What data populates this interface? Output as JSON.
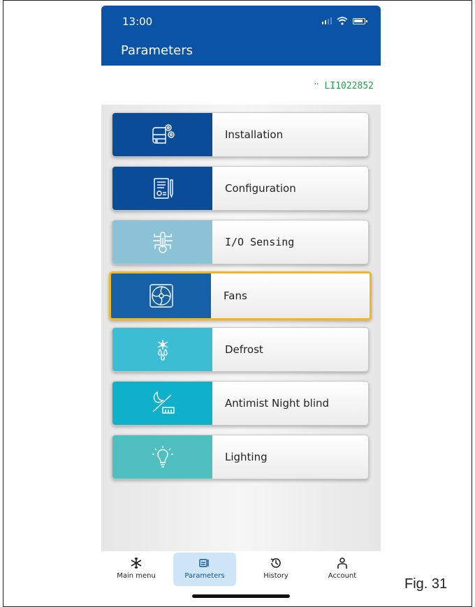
{
  "status_bar": {
    "time": "13:00"
  },
  "header": {
    "title": "Parameters"
  },
  "device": {
    "id": "LI1022852",
    "connection_icon": "bluetooth-signal-icon",
    "color": "#1aa34a"
  },
  "menu": {
    "items": [
      {
        "label": "Installation",
        "icon": "installation-icon",
        "icon_bg": "#0a4c98"
      },
      {
        "label": "Configuration",
        "icon": "configuration-icon",
        "icon_bg": "#0a4c98"
      },
      {
        "label": "I/O Sensing",
        "icon": "thermometer-icon",
        "icon_bg": "#8cc2d6"
      },
      {
        "label": "Fans",
        "icon": "fan-icon",
        "icon_bg": "#1660a8",
        "selected": true
      },
      {
        "label": "Defrost",
        "icon": "defrost-icon",
        "icon_bg": "#3dbdd3"
      },
      {
        "label": "Antimist Night blind",
        "icon": "night-blind-icon",
        "icon_bg": "#0fb0c9"
      },
      {
        "label": "Lighting",
        "icon": "lightbulb-icon",
        "icon_bg": "#4fc0bf"
      }
    ],
    "selected_border_color": "#f2b623"
  },
  "tabbar": {
    "tabs": [
      {
        "label": "Main menu",
        "icon": "snowflake-icon"
      },
      {
        "label": "Parameters",
        "icon": "parameters-icon",
        "active": true
      },
      {
        "label": "History",
        "icon": "history-icon"
      },
      {
        "label": "Account",
        "icon": "account-icon"
      }
    ]
  },
  "caption": "Fig. 31"
}
